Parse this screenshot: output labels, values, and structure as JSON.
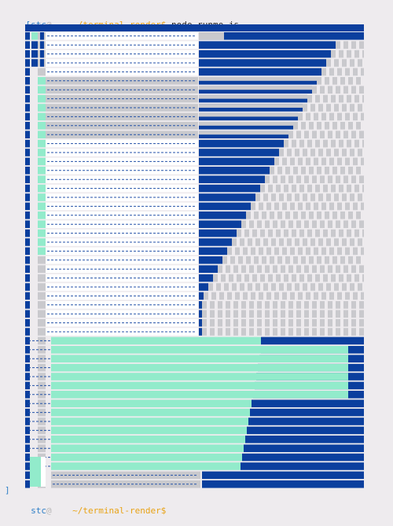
{
  "terminal": {
    "prompt1": {
      "bracket_open": "[",
      "user": "stc",
      "at": "@",
      "host_redacted": "    ",
      "path": "~/terminal-render$",
      "command": " node runme.js"
    },
    "prompt2": {
      "bracket_close": "]",
      "user": "stc",
      "at": "@",
      "host_redacted": "    ",
      "path": "~/terminal-render$"
    }
  },
  "colors": {
    "background": "#eeebee",
    "navy": "#0b3f9e",
    "mint": "#92ebcb",
    "gray": "#c9c9cd",
    "white": "#ffffff",
    "stripe": "#2452a8"
  }
}
